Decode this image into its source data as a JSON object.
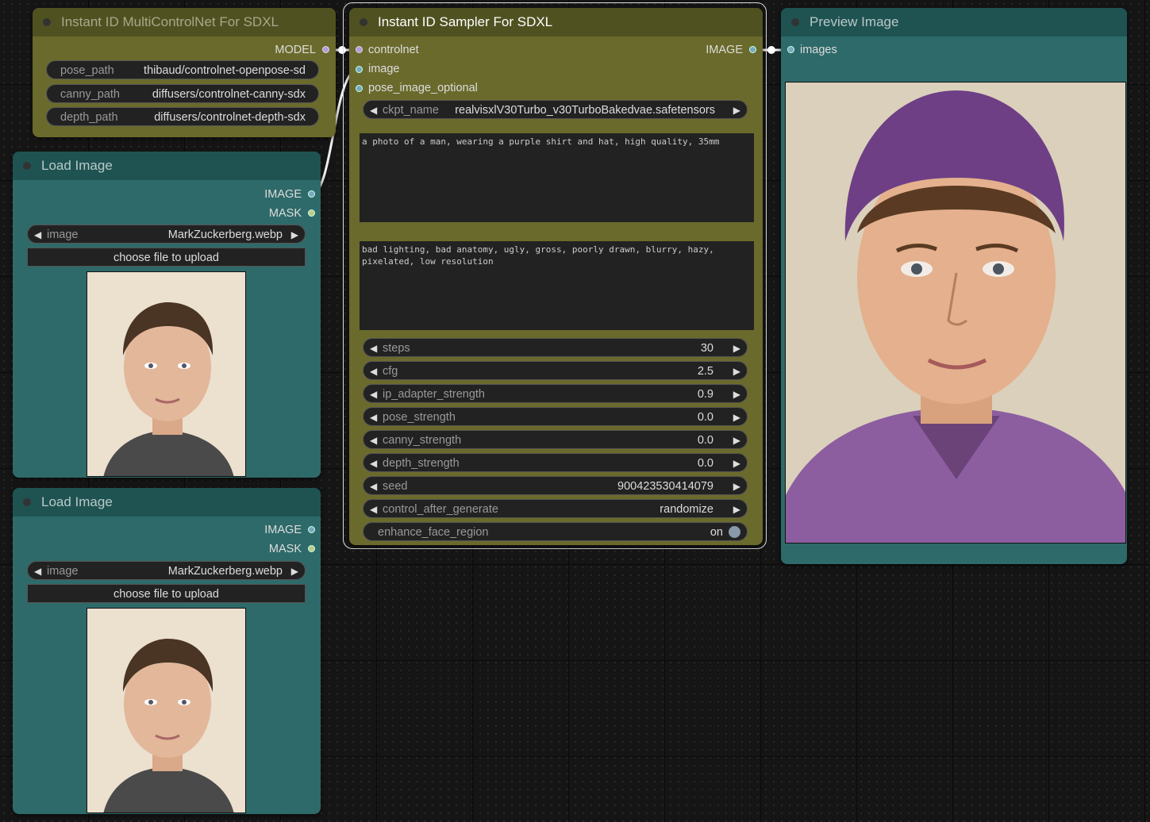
{
  "multicontrolnet": {
    "title": "Instant ID MultiControlNet For SDXL",
    "output_model": "MODEL",
    "widgets": [
      {
        "label": "pose_path",
        "value": "thibaud/controlnet-openpose-sd"
      },
      {
        "label": "canny_path",
        "value": "diffusers/controlnet-canny-sdx"
      },
      {
        "label": "depth_path",
        "value": "diffusers/controlnet-depth-sdx"
      }
    ]
  },
  "load_image_1": {
    "title": "Load Image",
    "output_image": "IMAGE",
    "output_mask": "MASK",
    "image_label": "image",
    "image_value": "MarkZuckerberg.webp",
    "upload_label": "choose file to upload"
  },
  "load_image_2": {
    "title": "Load Image",
    "output_image": "IMAGE",
    "output_mask": "MASK",
    "image_label": "image",
    "image_value": "MarkZuckerberg.webp",
    "upload_label": "choose file to upload"
  },
  "sampler": {
    "title": "Instant ID Sampler For SDXL",
    "inputs": [
      "controlnet",
      "image",
      "pose_image_optional"
    ],
    "output_image": "IMAGE",
    "ckpt_label": "ckpt_name",
    "ckpt_value": "realvisxlV30Turbo_v30TurboBakedvae.safetensors",
    "positive_prompt": "a photo of a man, wearing a purple shirt and hat, high quality, 35mm",
    "negative_prompt": "bad lighting, bad anatomy, ugly, gross, poorly drawn, blurry, hazy, pixelated, low resolution",
    "widgets": [
      {
        "label": "steps",
        "value": "30"
      },
      {
        "label": "cfg",
        "value": "2.5"
      },
      {
        "label": "ip_adapter_strength",
        "value": "0.9"
      },
      {
        "label": "pose_strength",
        "value": "0.0"
      },
      {
        "label": "canny_strength",
        "value": "0.0"
      },
      {
        "label": "depth_strength",
        "value": "0.0"
      },
      {
        "label": "seed",
        "value": "900423530414079"
      },
      {
        "label": "control_after_generate",
        "value": "randomize"
      }
    ],
    "toggle_label": "enhance_face_region",
    "toggle_value": "on"
  },
  "preview": {
    "title": "Preview Image",
    "input_images": "images"
  },
  "colors": {
    "olive_node": "#6a6a2c",
    "teal_node": "#2e6a69",
    "canvas": "#151515"
  }
}
